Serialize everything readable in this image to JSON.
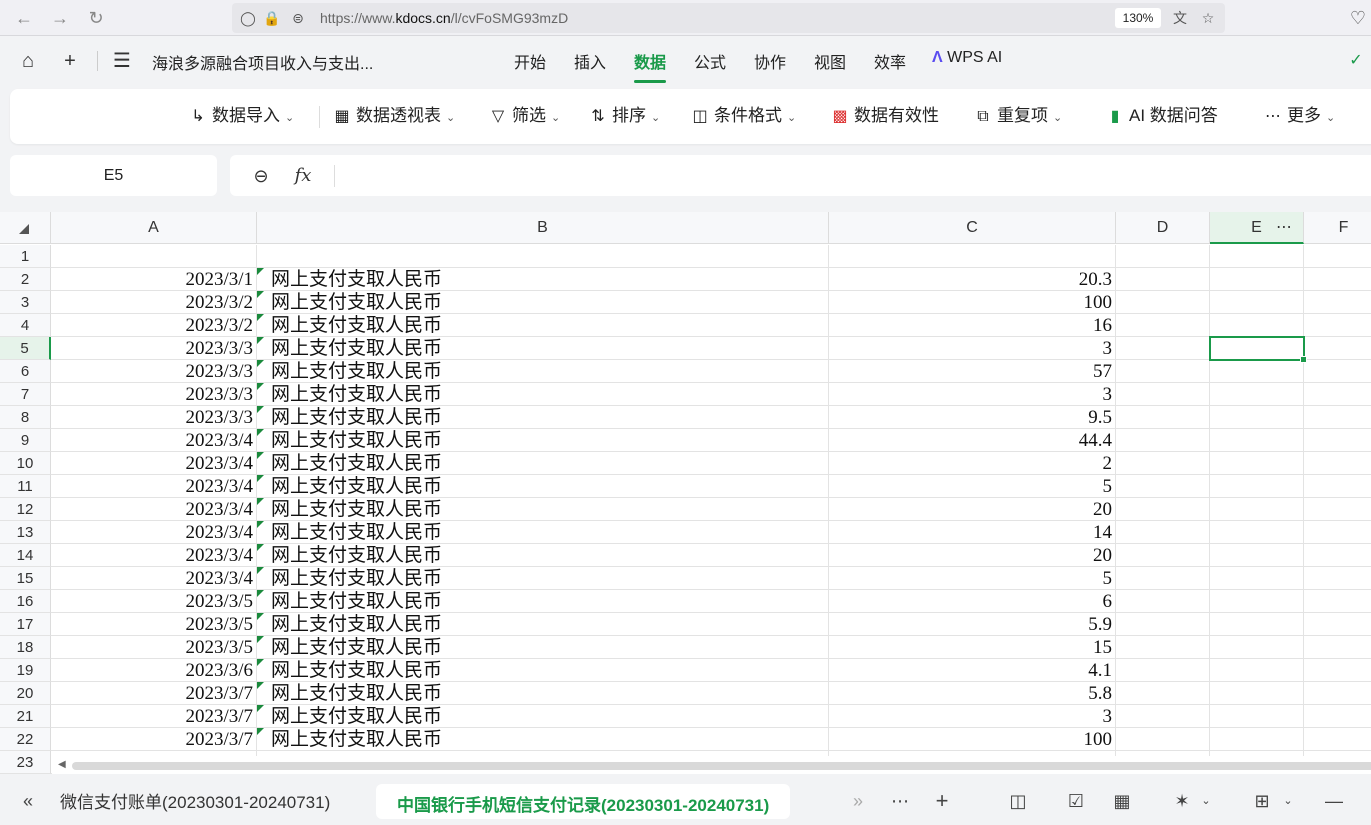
{
  "browser": {
    "url_prefix": "https://www.",
    "url_domain": "kdocs.cn",
    "url_path": "/l/cvFoSMG93mzD",
    "zoom": "130%"
  },
  "menu": {
    "doc_title": "海浪多源融合项目收入与支出...",
    "tabs": [
      "开始",
      "插入",
      "数据",
      "公式",
      "协作",
      "视图",
      "效率",
      "WPS AI"
    ],
    "active_tab": "数据"
  },
  "ribbon": {
    "import": "数据导入",
    "pivot": "数据透视表",
    "filter": "筛选",
    "sort": "排序",
    "conditional": "条件格式",
    "validity": "数据有效性",
    "duplicates": "重复项",
    "ai_qa": "AI 数据问答",
    "more": "更多"
  },
  "namebox": "E5",
  "formula_value": "",
  "columns": [
    "A",
    "B",
    "C",
    "D",
    "E",
    "F"
  ],
  "rows": [
    {
      "n": "1",
      "a": "",
      "b": "",
      "c": ""
    },
    {
      "n": "2",
      "a": "2023/3/1",
      "b": "网上支付支取人民币",
      "c": "20.3"
    },
    {
      "n": "3",
      "a": "2023/3/2",
      "b": "网上支付支取人民币",
      "c": "100"
    },
    {
      "n": "4",
      "a": "2023/3/2",
      "b": "网上支付支取人民币",
      "c": "16"
    },
    {
      "n": "5",
      "a": "2023/3/3",
      "b": "网上支付支取人民币",
      "c": "3"
    },
    {
      "n": "6",
      "a": "2023/3/3",
      "b": "网上支付支取人民币",
      "c": "57"
    },
    {
      "n": "7",
      "a": "2023/3/3",
      "b": "网上支付支取人民币",
      "c": "3"
    },
    {
      "n": "8",
      "a": "2023/3/3",
      "b": "网上支付支取人民币",
      "c": "9.5"
    },
    {
      "n": "9",
      "a": "2023/3/4",
      "b": "网上支付支取人民币",
      "c": "44.4"
    },
    {
      "n": "10",
      "a": "2023/3/4",
      "b": "网上支付支取人民币",
      "c": "2"
    },
    {
      "n": "11",
      "a": "2023/3/4",
      "b": "网上支付支取人民币",
      "c": "5"
    },
    {
      "n": "12",
      "a": "2023/3/4",
      "b": "网上支付支取人民币",
      "c": "20"
    },
    {
      "n": "13",
      "a": "2023/3/4",
      "b": "网上支付支取人民币",
      "c": "14"
    },
    {
      "n": "14",
      "a": "2023/3/4",
      "b": "网上支付支取人民币",
      "c": "20"
    },
    {
      "n": "15",
      "a": "2023/3/4",
      "b": "网上支付支取人民币",
      "c": "5"
    },
    {
      "n": "16",
      "a": "2023/3/5",
      "b": "网上支付支取人民币",
      "c": "6"
    },
    {
      "n": "17",
      "a": "2023/3/5",
      "b": "网上支付支取人民币",
      "c": "5.9"
    },
    {
      "n": "18",
      "a": "2023/3/5",
      "b": "网上支付支取人民币",
      "c": "15"
    },
    {
      "n": "19",
      "a": "2023/3/6",
      "b": "网上支付支取人民币",
      "c": "4.1"
    },
    {
      "n": "20",
      "a": "2023/3/7",
      "b": "网上支付支取人民币",
      "c": "5.8"
    },
    {
      "n": "21",
      "a": "2023/3/7",
      "b": "网上支付支取人民币",
      "c": "3"
    },
    {
      "n": "22",
      "a": "2023/3/7",
      "b": "网上支付支取人民币",
      "c": "100"
    },
    {
      "n": "23",
      "a": "",
      "b": "",
      "c": ""
    }
  ],
  "selected": {
    "col": "E",
    "row": "5"
  },
  "sheets": [
    {
      "label": "微信支付账单(20230301-20240731)",
      "active": false
    },
    {
      "label": "中国银行手机短信支付记录(20230301-20240731)",
      "active": true
    }
  ],
  "colors": {
    "accent": "#1a9a4a"
  }
}
